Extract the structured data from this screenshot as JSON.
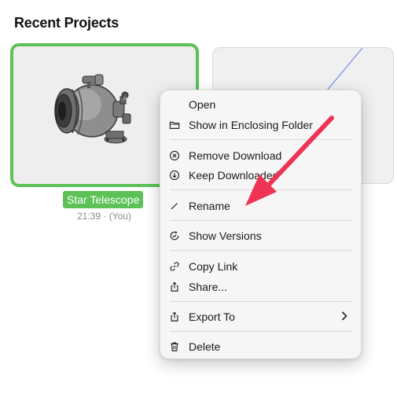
{
  "section_title": "Recent Projects",
  "project": {
    "name": "Star Telescope",
    "meta": "21:39 · (You)"
  },
  "context_menu": {
    "items": [
      {
        "label": "Open",
        "icon": ""
      },
      {
        "label": "Show in Enclosing Folder",
        "icon": "folder-icon"
      },
      {
        "label": "Remove Download",
        "icon": "remove-circle-icon"
      },
      {
        "label": "Keep Downloaded",
        "icon": "download-circle-icon"
      },
      {
        "label": "Rename",
        "icon": "pencil-icon"
      },
      {
        "label": "Show Versions",
        "icon": "versions-icon"
      },
      {
        "label": "Copy Link",
        "icon": "link-icon"
      },
      {
        "label": "Share...",
        "icon": "share-icon"
      },
      {
        "label": "Export To",
        "icon": "export-icon",
        "submenu": true
      },
      {
        "label": "Delete",
        "icon": "trash-icon"
      }
    ]
  },
  "colors": {
    "selection_green": "#5cc257",
    "annotation_arrow": "#ee3354"
  }
}
